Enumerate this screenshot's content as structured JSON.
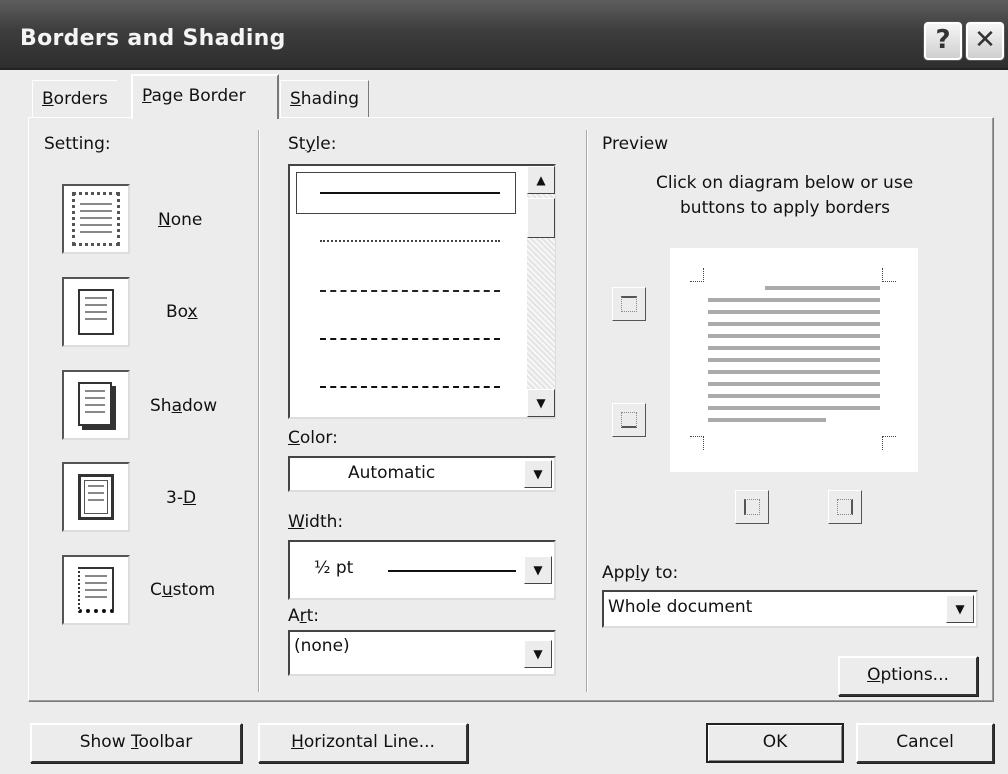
{
  "window": {
    "title": "Borders and Shading",
    "help_glyph": "?",
    "close_glyph": "✕"
  },
  "tabs": [
    {
      "pre": "",
      "key": "B",
      "post": "orders"
    },
    {
      "pre": "",
      "key": "P",
      "post": "age Border"
    },
    {
      "pre": "",
      "key": "S",
      "post": "hading"
    }
  ],
  "setting": {
    "label": "Setting:",
    "items": [
      {
        "pre": "",
        "key": "N",
        "post": "one"
      },
      {
        "pre": "Bo",
        "key": "x",
        "post": ""
      },
      {
        "pre": "Sh",
        "key": "a",
        "post": "dow"
      },
      {
        "pre": "3-",
        "key": "D",
        "post": ""
      },
      {
        "pre": "C",
        "key": "u",
        "post": "stom"
      }
    ]
  },
  "style": {
    "pre": "St",
    "key": "y",
    "post": "le:"
  },
  "color": {
    "pre": "",
    "key": "C",
    "post": "olor:",
    "value": "Automatic"
  },
  "width": {
    "pre": "",
    "key": "W",
    "post": "idth:",
    "value": "½ pt"
  },
  "art": {
    "pre": "A",
    "key": "r",
    "post": "t:",
    "value": "(none)"
  },
  "preview": {
    "label": "Preview",
    "hint_line1": "Click on diagram below or use",
    "hint_line2": "buttons to apply borders"
  },
  "apply_to": {
    "pre": "App",
    "key": "l",
    "post": "y to:",
    "value": "Whole document"
  },
  "buttons": {
    "options": {
      "pre": "",
      "key": "O",
      "post": "ptions..."
    },
    "show_toolbar": {
      "pre": "Show ",
      "key": "T",
      "post": "oolbar"
    },
    "horizontal_line": {
      "pre": "",
      "key": "H",
      "post": "orizontal Line..."
    },
    "ok": "OK",
    "cancel": "Cancel"
  },
  "icons": {
    "scroll_up": "▲",
    "scroll_down": "▼",
    "dropdown": "▼"
  }
}
